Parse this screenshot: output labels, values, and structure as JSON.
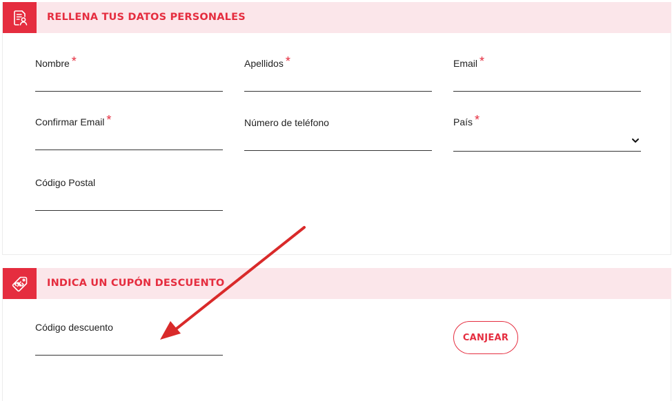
{
  "personal_section": {
    "title": "RELLENA TUS DATOS PERSONALES",
    "icon": "contact-form-icon",
    "fields": {
      "nombre": {
        "label": "Nombre",
        "required": "*",
        "value": ""
      },
      "apellidos": {
        "label": "Apellidos",
        "required": "*",
        "value": ""
      },
      "email": {
        "label": "Email",
        "required": "*",
        "value": ""
      },
      "confirmar_email": {
        "label": "Confirmar Email",
        "required": "*",
        "value": ""
      },
      "telefono": {
        "label": "Número de teléfono",
        "value": ""
      },
      "pais": {
        "label": "País",
        "required": "*",
        "selected": ""
      },
      "codigo_postal": {
        "label": "Código Postal",
        "value": ""
      }
    }
  },
  "coupon_section": {
    "title": "INDICA UN CUPÓN DESCUENTO",
    "icon": "discount-tag-icon",
    "field": {
      "label": "Código descuento",
      "value": ""
    },
    "redeem_label": "CANJEAR"
  },
  "colors": {
    "accent": "#e52d3f",
    "header_bg": "#fbe6ea",
    "annotation_arrow": "#d92a2a"
  }
}
